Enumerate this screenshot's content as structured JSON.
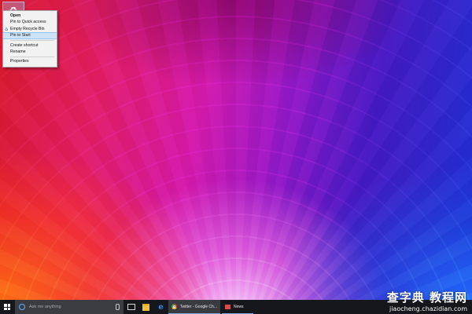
{
  "desktop": {
    "recycle_bin_icon": "recycle-bin-icon"
  },
  "context_menu": {
    "items": [
      {
        "label": "Open",
        "bold": true
      },
      {
        "label": "Pin to Quick access"
      },
      {
        "label": "Empty Recycle Bin",
        "icon": "recycle-bin-icon"
      },
      {
        "label": "Pin to Start",
        "highlighted": true
      },
      {
        "label": "Create shortcut"
      },
      {
        "label": "Rename"
      },
      {
        "label": "Properties"
      }
    ]
  },
  "taskbar": {
    "search_placeholder": "Ask me anything",
    "apps": [
      {
        "label": "Twitter - Google Ch...",
        "icon": "chrome-icon",
        "active": true
      },
      {
        "label": "News",
        "icon": "news-icon"
      }
    ]
  },
  "watermark": {
    "title": "查字典 教程网",
    "url": "jiaocheng.chazidian.com"
  },
  "colors": {
    "taskbar_bg": "#16171d",
    "search_bg": "#3b3c42",
    "menu_highlight": "#cde3f8",
    "cortana_blue": "#5ab2ff"
  }
}
